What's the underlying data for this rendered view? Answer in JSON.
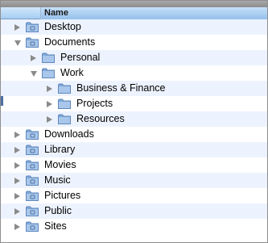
{
  "header": {
    "name_column": "Name"
  },
  "rows": [
    {
      "label": "Desktop",
      "state": "collapsed",
      "icon": "desktop-folder-icon"
    },
    {
      "label": "Documents",
      "state": "expanded",
      "icon": "documents-folder-icon"
    },
    {
      "label": "Personal",
      "state": "collapsed",
      "icon": "folder-icon"
    },
    {
      "label": "Work",
      "state": "expanded",
      "icon": "folder-icon"
    },
    {
      "label": "Business & Finance",
      "state": "collapsed",
      "icon": "folder-icon"
    },
    {
      "label": "Projects",
      "state": "collapsed",
      "icon": "folder-icon"
    },
    {
      "label": "Resources",
      "state": "collapsed",
      "icon": "folder-icon"
    },
    {
      "label": "Downloads",
      "state": "collapsed",
      "icon": "downloads-folder-icon"
    },
    {
      "label": "Library",
      "state": "collapsed",
      "icon": "library-folder-icon"
    },
    {
      "label": "Movies",
      "state": "collapsed",
      "icon": "movies-folder-icon"
    },
    {
      "label": "Music",
      "state": "collapsed",
      "icon": "music-folder-icon"
    },
    {
      "label": "Pictures",
      "state": "collapsed",
      "icon": "pictures-folder-icon"
    },
    {
      "label": "Public",
      "state": "collapsed",
      "icon": "public-folder-icon"
    },
    {
      "label": "Sites",
      "state": "collapsed",
      "icon": "sites-folder-icon"
    }
  ]
}
